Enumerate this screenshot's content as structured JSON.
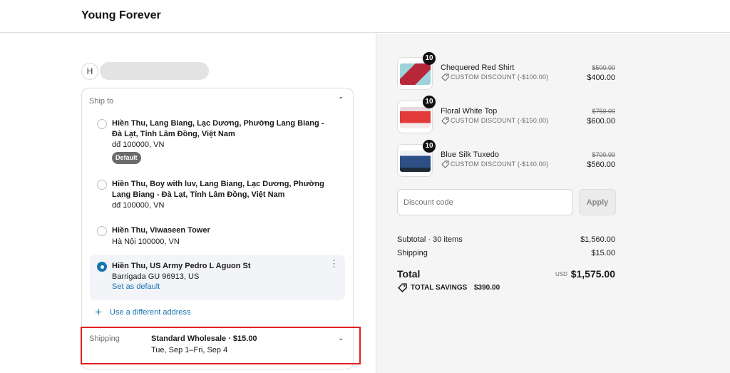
{
  "header": {
    "brand": "Young Forever"
  },
  "account": {
    "initial": "H"
  },
  "ship_to": {
    "title": "Ship to",
    "addresses": [
      {
        "name_lines": [
          "Hiền Thu, Lang Biang, Lạc Dương, Phường Lang Biang -",
          "Đà Lạt, Tỉnh Lâm Đồng, Việt Nam"
        ],
        "detail": "dđ 100000, VN",
        "badge": "Default",
        "selected": false
      },
      {
        "name_lines": [
          "Hiền Thu, Boy with luv, Lang Biang, Lạc Dương, Phường",
          "Lang Biang - Đà Lạt, Tỉnh Lâm Đồng, Việt Nam"
        ],
        "detail": "dđ 100000, VN",
        "selected": false
      },
      {
        "name_lines": [
          "Hiền Thu, Viwaseen Tower"
        ],
        "detail": "Hà Nội 100000, VN",
        "selected": false
      },
      {
        "name_lines": [
          "Hiền Thu, US Army Pedro L Aguon St"
        ],
        "detail": "Barrigada GU 96913, US",
        "action": "Set as default",
        "selected": true
      }
    ],
    "use_different": "Use a different address"
  },
  "shipping": {
    "label": "Shipping",
    "method": "Standard Wholesale · $15.00",
    "dates": "Tue, Sep 1–Fri, Sep 4"
  },
  "order": {
    "items": [
      {
        "name": "Chequered Red Shirt",
        "qty": "10",
        "discount": "CUSTOM DISCOUNT (-$100.00)",
        "original": "$500.00",
        "price": "$400.00",
        "thumb_color": "#c0392b"
      },
      {
        "name": "Floral White Top",
        "qty": "10",
        "discount": "CUSTOM DISCOUNT (-$150.00)",
        "original": "$750.00",
        "price": "$600.00",
        "thumb_color": "#e23a3a"
      },
      {
        "name": "Blue Silk Tuxedo",
        "qty": "10",
        "discount": "CUSTOM DISCOUNT (-$140.00)",
        "original": "$700.00",
        "price": "$560.00",
        "thumb_color": "#2c4f86"
      }
    ],
    "discount_placeholder": "Discount code",
    "apply_label": "Apply",
    "subtotal_label": "Subtotal · 30 items",
    "subtotal_value": "$1,560.00",
    "shipping_label": "Shipping",
    "shipping_value": "$15.00",
    "total_label": "Total",
    "currency": "USD",
    "total_value": "$1,575.00",
    "savings_label": "TOTAL SAVINGS",
    "savings_value": "$390.00"
  },
  "colors": {
    "accent": "#1773b0",
    "highlight_border": "#e02020"
  }
}
